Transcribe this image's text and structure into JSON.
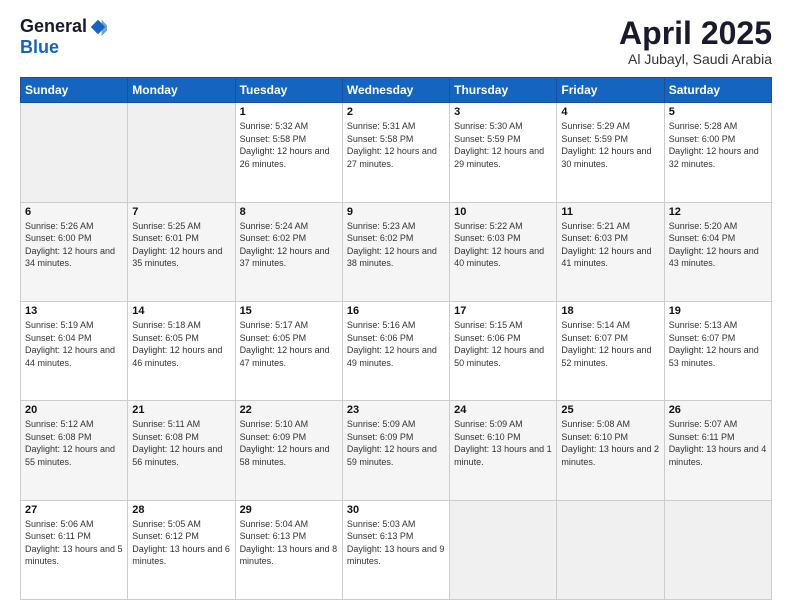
{
  "header": {
    "logo_general": "General",
    "logo_blue": "Blue",
    "title": "April 2025",
    "location": "Al Jubayl, Saudi Arabia"
  },
  "weekdays": [
    "Sunday",
    "Monday",
    "Tuesday",
    "Wednesday",
    "Thursday",
    "Friday",
    "Saturday"
  ],
  "weeks": [
    [
      {
        "day": "",
        "empty": true
      },
      {
        "day": "",
        "empty": true
      },
      {
        "day": "1",
        "sunrise": "Sunrise: 5:32 AM",
        "sunset": "Sunset: 5:58 PM",
        "daylight": "Daylight: 12 hours and 26 minutes."
      },
      {
        "day": "2",
        "sunrise": "Sunrise: 5:31 AM",
        "sunset": "Sunset: 5:58 PM",
        "daylight": "Daylight: 12 hours and 27 minutes."
      },
      {
        "day": "3",
        "sunrise": "Sunrise: 5:30 AM",
        "sunset": "Sunset: 5:59 PM",
        "daylight": "Daylight: 12 hours and 29 minutes."
      },
      {
        "day": "4",
        "sunrise": "Sunrise: 5:29 AM",
        "sunset": "Sunset: 5:59 PM",
        "daylight": "Daylight: 12 hours and 30 minutes."
      },
      {
        "day": "5",
        "sunrise": "Sunrise: 5:28 AM",
        "sunset": "Sunset: 6:00 PM",
        "daylight": "Daylight: 12 hours and 32 minutes."
      }
    ],
    [
      {
        "day": "6",
        "sunrise": "Sunrise: 5:26 AM",
        "sunset": "Sunset: 6:00 PM",
        "daylight": "Daylight: 12 hours and 34 minutes."
      },
      {
        "day": "7",
        "sunrise": "Sunrise: 5:25 AM",
        "sunset": "Sunset: 6:01 PM",
        "daylight": "Daylight: 12 hours and 35 minutes."
      },
      {
        "day": "8",
        "sunrise": "Sunrise: 5:24 AM",
        "sunset": "Sunset: 6:02 PM",
        "daylight": "Daylight: 12 hours and 37 minutes."
      },
      {
        "day": "9",
        "sunrise": "Sunrise: 5:23 AM",
        "sunset": "Sunset: 6:02 PM",
        "daylight": "Daylight: 12 hours and 38 minutes."
      },
      {
        "day": "10",
        "sunrise": "Sunrise: 5:22 AM",
        "sunset": "Sunset: 6:03 PM",
        "daylight": "Daylight: 12 hours and 40 minutes."
      },
      {
        "day": "11",
        "sunrise": "Sunrise: 5:21 AM",
        "sunset": "Sunset: 6:03 PM",
        "daylight": "Daylight: 12 hours and 41 minutes."
      },
      {
        "day": "12",
        "sunrise": "Sunrise: 5:20 AM",
        "sunset": "Sunset: 6:04 PM",
        "daylight": "Daylight: 12 hours and 43 minutes."
      }
    ],
    [
      {
        "day": "13",
        "sunrise": "Sunrise: 5:19 AM",
        "sunset": "Sunset: 6:04 PM",
        "daylight": "Daylight: 12 hours and 44 minutes."
      },
      {
        "day": "14",
        "sunrise": "Sunrise: 5:18 AM",
        "sunset": "Sunset: 6:05 PM",
        "daylight": "Daylight: 12 hours and 46 minutes."
      },
      {
        "day": "15",
        "sunrise": "Sunrise: 5:17 AM",
        "sunset": "Sunset: 6:05 PM",
        "daylight": "Daylight: 12 hours and 47 minutes."
      },
      {
        "day": "16",
        "sunrise": "Sunrise: 5:16 AM",
        "sunset": "Sunset: 6:06 PM",
        "daylight": "Daylight: 12 hours and 49 minutes."
      },
      {
        "day": "17",
        "sunrise": "Sunrise: 5:15 AM",
        "sunset": "Sunset: 6:06 PM",
        "daylight": "Daylight: 12 hours and 50 minutes."
      },
      {
        "day": "18",
        "sunrise": "Sunrise: 5:14 AM",
        "sunset": "Sunset: 6:07 PM",
        "daylight": "Daylight: 12 hours and 52 minutes."
      },
      {
        "day": "19",
        "sunrise": "Sunrise: 5:13 AM",
        "sunset": "Sunset: 6:07 PM",
        "daylight": "Daylight: 12 hours and 53 minutes."
      }
    ],
    [
      {
        "day": "20",
        "sunrise": "Sunrise: 5:12 AM",
        "sunset": "Sunset: 6:08 PM",
        "daylight": "Daylight: 12 hours and 55 minutes."
      },
      {
        "day": "21",
        "sunrise": "Sunrise: 5:11 AM",
        "sunset": "Sunset: 6:08 PM",
        "daylight": "Daylight: 12 hours and 56 minutes."
      },
      {
        "day": "22",
        "sunrise": "Sunrise: 5:10 AM",
        "sunset": "Sunset: 6:09 PM",
        "daylight": "Daylight: 12 hours and 58 minutes."
      },
      {
        "day": "23",
        "sunrise": "Sunrise: 5:09 AM",
        "sunset": "Sunset: 6:09 PM",
        "daylight": "Daylight: 12 hours and 59 minutes."
      },
      {
        "day": "24",
        "sunrise": "Sunrise: 5:09 AM",
        "sunset": "Sunset: 6:10 PM",
        "daylight": "Daylight: 13 hours and 1 minute."
      },
      {
        "day": "25",
        "sunrise": "Sunrise: 5:08 AM",
        "sunset": "Sunset: 6:10 PM",
        "daylight": "Daylight: 13 hours and 2 minutes."
      },
      {
        "day": "26",
        "sunrise": "Sunrise: 5:07 AM",
        "sunset": "Sunset: 6:11 PM",
        "daylight": "Daylight: 13 hours and 4 minutes."
      }
    ],
    [
      {
        "day": "27",
        "sunrise": "Sunrise: 5:06 AM",
        "sunset": "Sunset: 6:11 PM",
        "daylight": "Daylight: 13 hours and 5 minutes."
      },
      {
        "day": "28",
        "sunrise": "Sunrise: 5:05 AM",
        "sunset": "Sunset: 6:12 PM",
        "daylight": "Daylight: 13 hours and 6 minutes."
      },
      {
        "day": "29",
        "sunrise": "Sunrise: 5:04 AM",
        "sunset": "Sunset: 6:13 PM",
        "daylight": "Daylight: 13 hours and 8 minutes."
      },
      {
        "day": "30",
        "sunrise": "Sunrise: 5:03 AM",
        "sunset": "Sunset: 6:13 PM",
        "daylight": "Daylight: 13 hours and 9 minutes."
      },
      {
        "day": "",
        "empty": true
      },
      {
        "day": "",
        "empty": true
      },
      {
        "day": "",
        "empty": true
      }
    ]
  ]
}
